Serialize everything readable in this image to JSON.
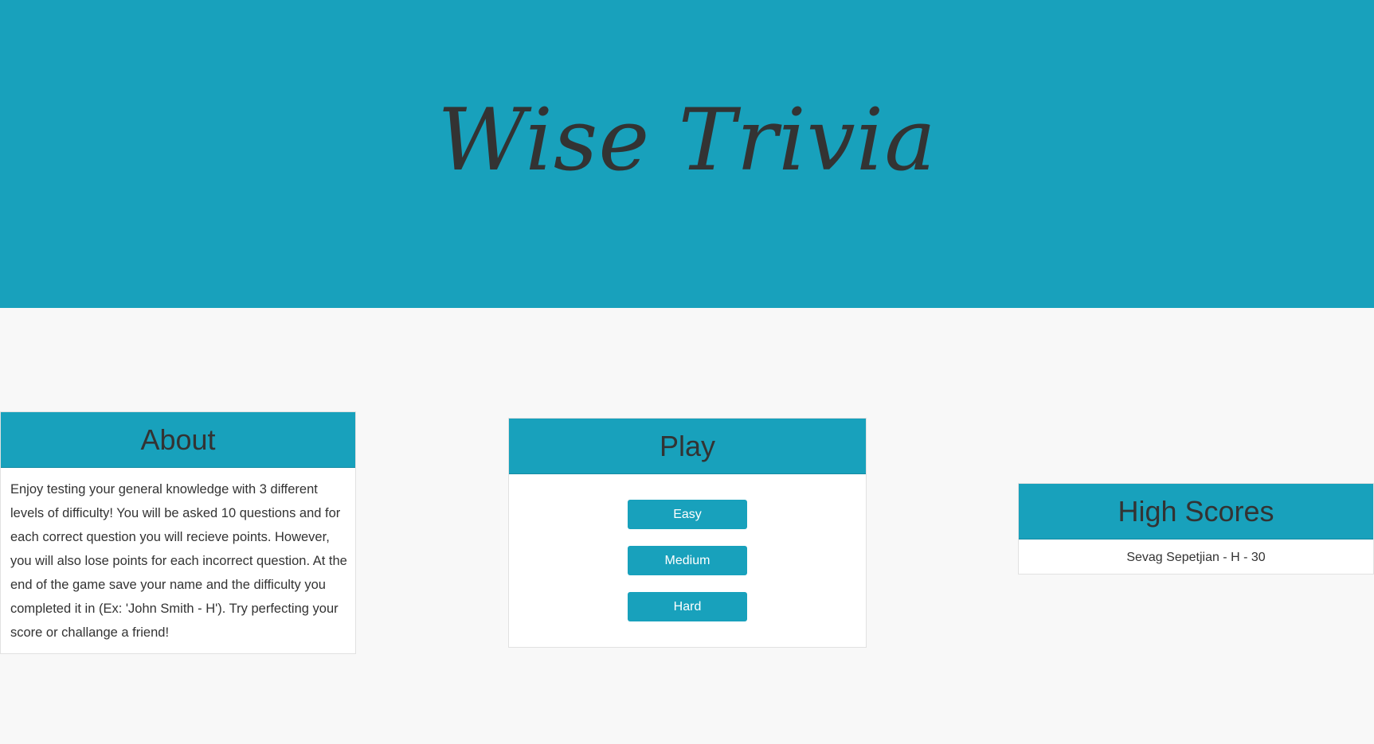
{
  "header": {
    "title": "Wise Trivia"
  },
  "about": {
    "heading": "About",
    "text": "Enjoy testing your general knowledge with 3 different levels of difficulty! You will be asked 10 questions and for each correct question you will recieve points. However, you will also lose points for each incorrect question. At the end of the game save your name and the difficulty you completed it in (Ex: 'John Smith - H'). Try perfecting your score or challange a friend!"
  },
  "play": {
    "heading": "Play",
    "buttons": {
      "easy": "Easy",
      "medium": "Medium",
      "hard": "Hard"
    }
  },
  "high_scores": {
    "heading": "High Scores",
    "entries": [
      "Sevag Sepetjian - H - 30"
    ]
  },
  "colors": {
    "accent": "#18a1bc",
    "background": "#f8f8f8",
    "text": "#333333",
    "panel": "#ffffff"
  }
}
